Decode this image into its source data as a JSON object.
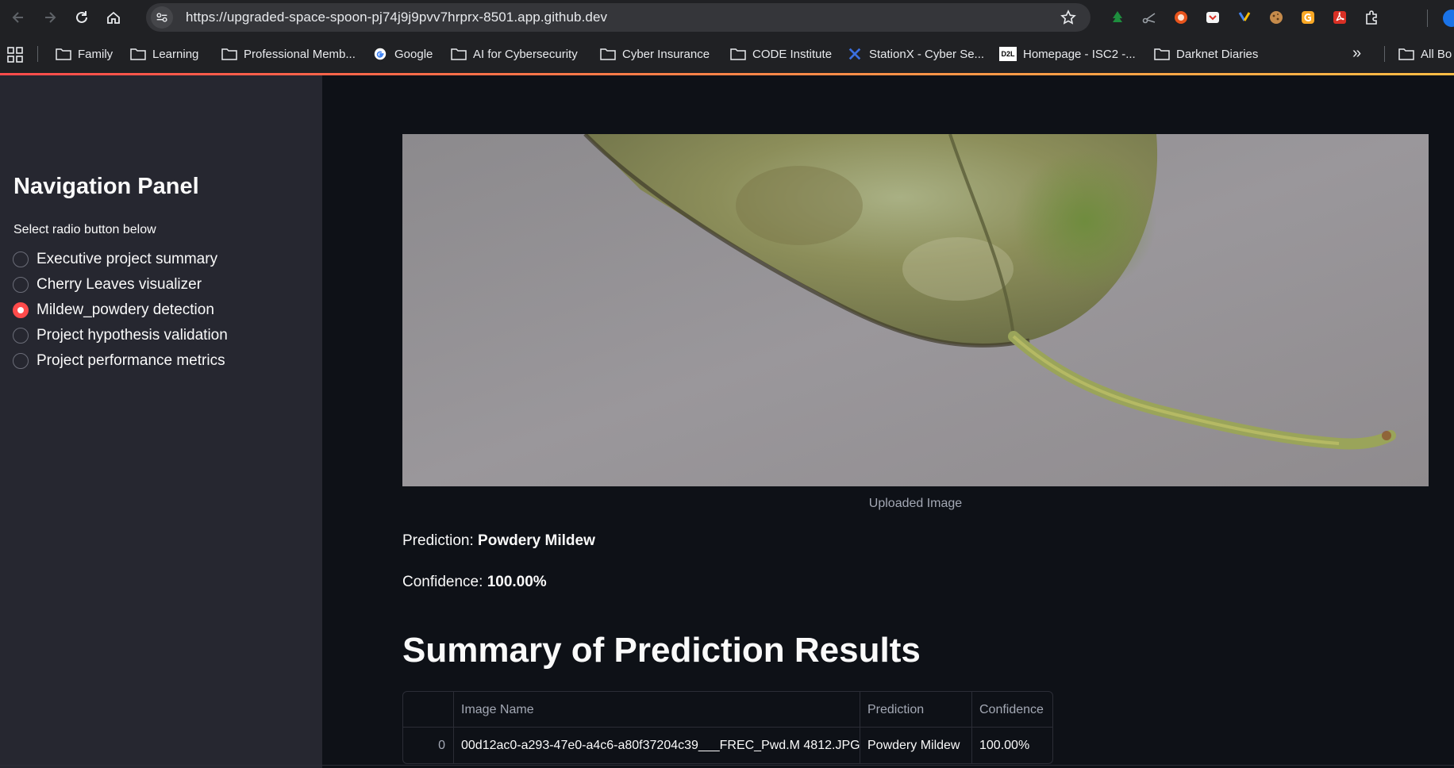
{
  "browser": {
    "url": "https://upgraded-space-spoon-pj74j9j9pvv7hrprx-8501.app.github.dev",
    "bookmarks": [
      {
        "label": "Family",
        "icon": "folder-icon"
      },
      {
        "label": "Learning",
        "icon": "folder-icon"
      },
      {
        "label": "Professional Memb...",
        "icon": "folder-icon"
      },
      {
        "label": "Google",
        "icon": "google-icon"
      },
      {
        "label": "AI for Cybersecurity",
        "icon": "folder-icon"
      },
      {
        "label": "Cyber Insurance",
        "icon": "folder-icon"
      },
      {
        "label": "CODE Institute",
        "icon": "folder-icon"
      },
      {
        "label": "StationX - Cyber Se...",
        "icon": "stationx-icon"
      },
      {
        "label": "Homepage - ISC2 -...",
        "icon": "d2l-icon"
      },
      {
        "label": "Darknet Diaries",
        "icon": "folder-icon"
      }
    ],
    "more": "»",
    "all_bookmarks": "All Bo",
    "d2l_text": "D2L"
  },
  "sidebar": {
    "title": "Navigation Panel",
    "subtitle": "Select radio button below",
    "options": [
      {
        "label": "Executive project summary",
        "selected": false
      },
      {
        "label": "Cherry Leaves visualizer",
        "selected": false
      },
      {
        "label": "Mildew_powdery detection",
        "selected": true
      },
      {
        "label": "Project hypothesis validation",
        "selected": false
      },
      {
        "label": "Project performance metrics",
        "selected": false
      }
    ]
  },
  "main": {
    "image_caption": "Uploaded Image",
    "prediction_label": "Prediction: ",
    "prediction_value": "Powdery Mildew",
    "confidence_label": "Confidence: ",
    "confidence_value": "100.00%",
    "summary_title": "Summary of Prediction Results",
    "table": {
      "headers": [
        "",
        "Image Name",
        "Prediction",
        "Confidence"
      ],
      "rows": [
        [
          "0",
          "00d12ac0-a293-47e0-a4c6-a80f37204c39___FREC_Pwd.M 4812.JPG",
          "Powdery Mildew",
          "100.00%"
        ]
      ]
    }
  },
  "colors": {
    "accent": "#ff4b4b",
    "sidebar_bg": "#262730",
    "main_bg": "#0e1117",
    "chrome_bg": "#202124"
  }
}
